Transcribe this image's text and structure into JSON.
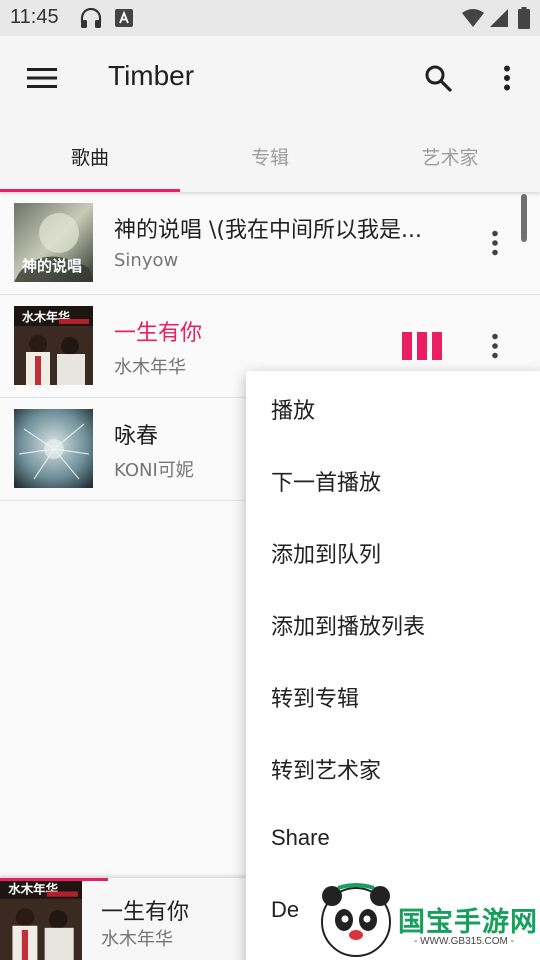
{
  "status_bar": {
    "time": "11:45",
    "left_icons": [
      "headphones-icon",
      "text-a-icon"
    ],
    "right_icons": [
      "wifi-icon",
      "cell-signal-icon",
      "battery-icon"
    ]
  },
  "app_bar": {
    "title": "Timber",
    "menu_icon": "hamburger-menu-icon",
    "search_icon": "search-icon",
    "overflow_icon": "more-vertical-icon"
  },
  "tabs": [
    {
      "label": "歌曲",
      "active": true
    },
    {
      "label": "专辑",
      "active": false
    },
    {
      "label": "艺术家",
      "active": false
    }
  ],
  "songs": [
    {
      "title": "神的说唱 \\(我在中间所以我是...",
      "artist": "Sinyow",
      "art": "album-art-shendeshuochang",
      "playing": false
    },
    {
      "title": "一生有你",
      "artist": "水木年华",
      "art": "album-art-shuimunianhua",
      "playing": true
    },
    {
      "title": "咏春",
      "artist": "KONI可妮",
      "art": "album-art-yongchun",
      "playing": false
    }
  ],
  "popup_menu": {
    "items": [
      "播放",
      "下一首播放",
      "添加到队列",
      "添加到播放列表",
      "转到专辑",
      "转到艺术家",
      "Share",
      "De"
    ]
  },
  "mini_player": {
    "title": "一生有你",
    "artist": "水木年华",
    "progress": 0.2
  },
  "watermark": {
    "brand": "国宝手游网",
    "url": "- WWW.GB315.COM -"
  },
  "colors": {
    "accent": "#e91e63",
    "text_primary": "#212121",
    "text_secondary": "#757575",
    "watermark_green": "#17a05d"
  }
}
